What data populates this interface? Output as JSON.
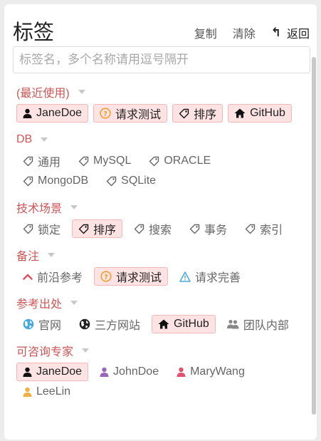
{
  "header": {
    "title": "标签",
    "copy": "复制",
    "clear": "清除",
    "back": "返回"
  },
  "search": {
    "placeholder": "标签名，多个名称请用逗号隔开",
    "value": ""
  },
  "groups": [
    {
      "title": "(最近使用)",
      "tags": [
        {
          "label": "JaneDoe",
          "icon": "user-icon",
          "selected": true
        },
        {
          "label": "请求测试",
          "icon": "question-icon",
          "selected": true
        },
        {
          "label": "排序",
          "icon": "tag-icon",
          "selected": true
        },
        {
          "label": "GitHub",
          "icon": "home-icon",
          "selected": true
        }
      ]
    },
    {
      "title": "DB",
      "tags": [
        {
          "label": "通用",
          "icon": "tag-icon",
          "selected": false
        },
        {
          "label": "MySQL",
          "icon": "tag-icon",
          "selected": false
        },
        {
          "label": "ORACLE",
          "icon": "tag-icon",
          "selected": false
        },
        {
          "label": "MongoDB",
          "icon": "tag-icon",
          "selected": false
        },
        {
          "label": "SQLite",
          "icon": "tag-icon",
          "selected": false
        }
      ]
    },
    {
      "title": "技术场景",
      "tags": [
        {
          "label": "锁定",
          "icon": "tag-icon",
          "selected": false
        },
        {
          "label": "排序",
          "icon": "tag-icon",
          "selected": true
        },
        {
          "label": "搜索",
          "icon": "tag-icon",
          "selected": false
        },
        {
          "label": "事务",
          "icon": "tag-icon",
          "selected": false
        },
        {
          "label": "索引",
          "icon": "tag-icon",
          "selected": false
        }
      ]
    },
    {
      "title": "备注",
      "tags": [
        {
          "label": "前沿参考",
          "icon": "chevron-up-icon",
          "selected": false
        },
        {
          "label": "请求测试",
          "icon": "question-icon",
          "selected": true
        },
        {
          "label": "请求完善",
          "icon": "warning-icon",
          "selected": false
        }
      ]
    },
    {
      "title": "参考出处",
      "tags": [
        {
          "label": "官网",
          "icon": "globe-icon",
          "selected": false
        },
        {
          "label": "三方网站",
          "icon": "globe-dark-icon",
          "selected": false
        },
        {
          "label": "GitHub",
          "icon": "home-icon",
          "selected": true
        },
        {
          "label": "团队内部",
          "icon": "team-icon",
          "selected": false
        }
      ]
    },
    {
      "title": "可咨询专家",
      "tags": [
        {
          "label": "JaneDoe",
          "icon": "user-icon",
          "selected": true
        },
        {
          "label": "JohnDoe",
          "icon": "user-purple-icon",
          "selected": false
        },
        {
          "label": "MaryWang",
          "icon": "user-red-icon",
          "selected": false
        },
        {
          "label": "LeeLin",
          "icon": "user-orange-icon",
          "selected": false
        }
      ]
    }
  ],
  "colors": {
    "accent": "#cc5555",
    "selected_bg": "#fde3e3",
    "selected_border": "#f2b8b8"
  }
}
